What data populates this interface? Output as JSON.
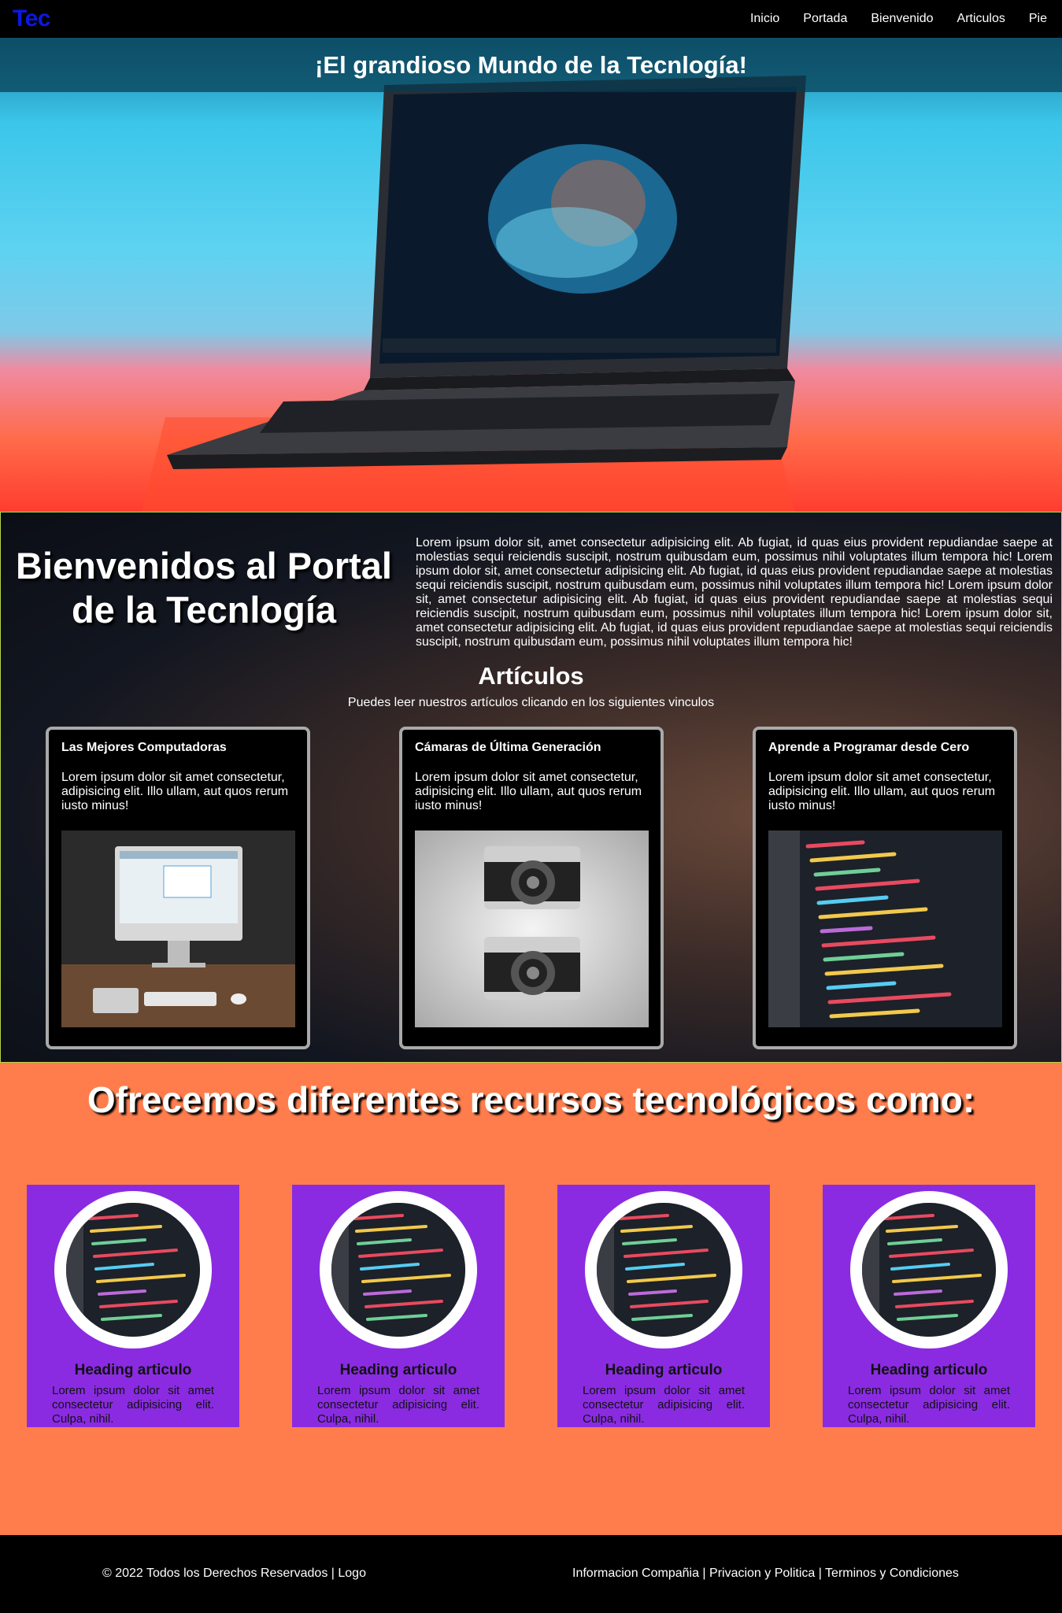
{
  "nav": {
    "brand": "Tec",
    "links": [
      "Inicio",
      "Portada",
      "Bienvenido",
      "Articulos",
      "Pie"
    ]
  },
  "hero": {
    "title": "¡El grandioso Mundo de la Tecnlogía!"
  },
  "welcome": {
    "title": "Bienvenidos al Portal de la Tecnlogía",
    "text": "Lorem ipsum dolor sit, amet consectetur adipisicing elit. Ab fugiat, id quas eius provident repudiandae saepe at molestias sequi reiciendis suscipit, nostrum quibusdam eum, possimus nihil voluptates illum tempora hic! Lorem ipsum dolor sit, amet consectetur adipisicing elit. Ab fugiat, id quas eius provident repudiandae saepe at molestias sequi reiciendis suscipit, nostrum quibusdam eum, possimus nihil voluptates illum tempora hic! Lorem ipsum dolor sit, amet consectetur adipisicing elit. Ab fugiat, id quas eius provident repudiandae saepe at molestias sequi reiciendis suscipit, nostrum quibusdam eum, possimus nihil voluptates illum tempora hic! Lorem ipsum dolor sit, amet consectetur adipisicing elit. Ab fugiat, id quas eius provident repudiandae saepe at molestias sequi reiciendis suscipit, nostrum quibusdam eum, possimus nihil voluptates illum tempora hic!"
  },
  "articles": {
    "title": "Artículos",
    "subtitle": "Puedes leer nuestros artículos clicando en los siguientes vinculos",
    "cards": [
      {
        "title": "Las Mejores Computadoras",
        "text": "Lorem ipsum dolor sit amet consectetur, adipisicing elit. Illo ullam, aut quos rerum iusto minus!"
      },
      {
        "title": "Cámaras de Última Generación",
        "text": "Lorem ipsum dolor sit amet consectetur, adipisicing elit. Illo ullam, aut quos rerum iusto minus!"
      },
      {
        "title": "Aprende a Programar desde Cero",
        "text": "Lorem ipsum dolor sit amet consectetur, adipisicing elit. Illo ullam, aut quos rerum iusto minus!"
      }
    ]
  },
  "resources": {
    "title": "Ofrecemos diferentes recursos tecnológicos como:",
    "cards": [
      {
        "heading": "Heading articulo",
        "text": "Lorem ipsum dolor sit amet consectetur adipisicing elit. Culpa, nihil."
      },
      {
        "heading": "Heading articulo",
        "text": "Lorem ipsum dolor sit amet consectetur adipisicing elit. Culpa, nihil."
      },
      {
        "heading": "Heading articulo",
        "text": "Lorem ipsum dolor sit amet consectetur adipisicing elit. Culpa, nihil."
      },
      {
        "heading": "Heading articulo",
        "text": "Lorem ipsum dolor sit amet consectetur adipisicing elit. Culpa, nihil."
      }
    ]
  },
  "footer": {
    "left": "© 2022 Todos los Derechos Reservados | Logo",
    "right": "Informacion Compañia | Privacion y Politica | Terminos y Condiciones"
  },
  "colors": {
    "brand": "#0a18e6",
    "resources_bg": "#ff7d4d",
    "resource_card": "#8a2be2"
  }
}
